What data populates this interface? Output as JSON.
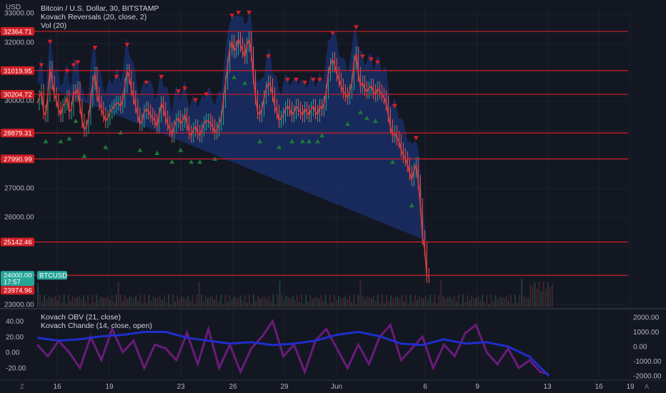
{
  "header": {
    "currency": "USD",
    "legend_lines": [
      "Bitcoin / U.S. Dollar, 30, BITSTAMP",
      "Kovach Reversals (20, close, 2)",
      "Vol (20)"
    ]
  },
  "lower_pane": {
    "legend_lines": [
      "Kovach OBV (21, close)",
      "Kovach Chande (14, close, open)"
    ]
  },
  "colors": {
    "background": "#131722",
    "grid": "#1e222d",
    "hline": "#d11f26",
    "label_red": "#d11f26",
    "label_green": "#26a69a",
    "band": "#1e3a8a",
    "up_marker": "#1b7a3a",
    "down_marker": "#d11f26",
    "obv": "#1f2ecc",
    "chande": "#6a1b7a"
  },
  "icons": {
    "bottom_left": "Z",
    "bottom_right": "A"
  },
  "chart_data": [
    {
      "type": "line",
      "name": "BTCUSD price",
      "y_axis_ticks": [
        "33000.00",
        "32000.00",
        "30000.00",
        "27000.00",
        "26000.00",
        "23000.00"
      ],
      "ylim": [
        23000,
        33000
      ],
      "x_tick_labels": [
        "16",
        "19",
        "23",
        "26",
        "29",
        "Jun",
        "6",
        "9",
        "13",
        "16",
        "19"
      ],
      "horizontal_levels": [
        32364.71,
        31019.95,
        30204.72,
        28879.31,
        27990.99,
        25142.46,
        24000.0
      ],
      "price_labels": [
        {
          "text": "32364.71",
          "kind": "level"
        },
        {
          "text": "31019.95",
          "kind": "level"
        },
        {
          "text": "30204.72",
          "kind": "level"
        },
        {
          "text": "28879.31",
          "kind": "level"
        },
        {
          "text": "27990.99",
          "kind": "level"
        },
        {
          "text": "25142.46",
          "kind": "level"
        },
        {
          "text": "24000.00",
          "kind": "current"
        },
        {
          "text": "17:57",
          "kind": "countdown"
        },
        {
          "text": "23974.96",
          "kind": "level"
        }
      ],
      "symbol_tag": "BTCUSD",
      "x": [
        0,
        3,
        6,
        9,
        12,
        15,
        18,
        21,
        24,
        27,
        30,
        33,
        36,
        39,
        42,
        45,
        48,
        51,
        54,
        57,
        60,
        63,
        66,
        69,
        72,
        75,
        78,
        81,
        84,
        87,
        90,
        93,
        96,
        99,
        102,
        105,
        108,
        111,
        114,
        117,
        120,
        123,
        126,
        129,
        132,
        135,
        138,
        141,
        144,
        147,
        150,
        153,
        156,
        159,
        162,
        165,
        168,
        171,
        174,
        177,
        180,
        183,
        186,
        189,
        192,
        195,
        198,
        201,
        204,
        207,
        210,
        213,
        216,
        219,
        222,
        225,
        228,
        231,
        234,
        237,
        240,
        243,
        246,
        249,
        252,
        255,
        258,
        261,
        264,
        267,
        270,
        273,
        276,
        279,
        282,
        285,
        288,
        291,
        294,
        297,
        300,
        303,
        306,
        309,
        312,
        315,
        318,
        321,
        324,
        327,
        330,
        333,
        336,
        339,
        342,
        345,
        348,
        351,
        354,
        357,
        360,
        363,
        366,
        369,
        372,
        375,
        378,
        381,
        384,
        387,
        390,
        393,
        396,
        399,
        402,
        405,
        408,
        411,
        414,
        417,
        420,
        423,
        426,
        429,
        432,
        435,
        438,
        441,
        444,
        447,
        450,
        453,
        456,
        459,
        462,
        465,
        468,
        471,
        474,
        477,
        480,
        483,
        486,
        489,
        492,
        495,
        498,
        501,
        504,
        507,
        510,
        513,
        516,
        519,
        522,
        525,
        528,
        531,
        534,
        537,
        540,
        543,
        546,
        549,
        552,
        555,
        558,
        561,
        564,
        567,
        570,
        573,
        576,
        579,
        582,
        585,
        588,
        591,
        594,
        597,
        600,
        603,
        606,
        609,
        612,
        615,
        618,
        621,
        624,
        627,
        630,
        633,
        636,
        639,
        642,
        645,
        648,
        651,
        654,
        657,
        660,
        663,
        666,
        669,
        672,
        675,
        678,
        681,
        684,
        687,
        690,
        693,
        696,
        699,
        702,
        705,
        708,
        711,
        714,
        717
      ],
      "y": [
        29900,
        30100,
        30300,
        29600,
        29500,
        30200,
        31100,
        30600,
        30200,
        30000,
        29700,
        29500,
        29800,
        29900,
        30100,
        29600,
        29700,
        30300,
        30200,
        30400,
        29800,
        29300,
        29000,
        29100,
        29400,
        30000,
        30600,
        30900,
        30200,
        29900,
        29700,
        29500,
        29300,
        29400,
        29600,
        29700,
        29800,
        29900,
        29900,
        29800,
        30000,
        30500,
        31000,
        30800,
        30400,
        30100,
        29800,
        29500,
        29200,
        29300,
        29600,
        29700,
        29600,
        29500,
        29400,
        29300,
        29100,
        29500,
        29900,
        29700,
        29400,
        29200,
        29000,
        28800,
        29100,
        29300,
        29400,
        29200,
        29300,
        29500,
        29200,
        28900,
        28800,
        29000,
        29100,
        28900,
        28800,
        29000,
        29200,
        29300,
        29300,
        29200,
        29100,
        28900,
        29000,
        29200,
        29400,
        30000,
        30600,
        31200,
        31800,
        32000,
        31700,
        31800,
        32100,
        31900,
        31700,
        31500,
        31900,
        32100,
        31600,
        30800,
        30100,
        29600,
        29500,
        29700,
        30100,
        30400,
        30600,
        30500,
        30200,
        29800,
        29600,
        29300,
        29400,
        29500,
        29700,
        29800,
        29700,
        29500,
        29600,
        29800,
        29700,
        29600,
        29500,
        29700,
        29600,
        29500,
        29700,
        29800,
        29600,
        29500,
        29800,
        29700,
        29900,
        30300,
        30900,
        31200,
        31400,
        31200,
        30900,
        30700,
        30500,
        30300,
        30200,
        30100,
        30300,
        30600,
        31300,
        31600,
        30900,
        30500,
        30600,
        30400,
        30300,
        30400,
        30500,
        30300,
        30200,
        30400,
        30300,
        30200,
        30100,
        29900,
        29500,
        29100,
        28800,
        28900,
        28700,
        28600,
        28300,
        28100,
        28000,
        27800,
        27500,
        27300,
        27600,
        27800,
        27200,
        26400,
        25300,
        24900,
        24000,
        23975
      ]
    },
    {
      "type": "line",
      "name": "Kovach OBV",
      "y_axis_ticks": [
        "2000.00",
        "1000.00",
        "0.00",
        "-1000.00",
        "-2000.00"
      ],
      "ylim": [
        -2000,
        2000
      ],
      "x": [
        0,
        30,
        60,
        90,
        120,
        150,
        180,
        210,
        240,
        270,
        300,
        330,
        360,
        390,
        420,
        450,
        480,
        510,
        540,
        570,
        600,
        630,
        660,
        690,
        717
      ],
      "y": [
        600,
        400,
        500,
        700,
        800,
        1000,
        1000,
        600,
        400,
        200,
        300,
        100,
        200,
        400,
        800,
        1000,
        700,
        200,
        100,
        500,
        200,
        300,
        0,
        -700,
        -2000
      ]
    },
    {
      "type": "line",
      "name": "Kovach Chande",
      "y_axis_ticks": [
        "40.00",
        "20.00",
        "0.00",
        "-20.00"
      ],
      "ylim": [
        -30,
        45
      ],
      "x": [
        0,
        15,
        30,
        45,
        60,
        75,
        90,
        105,
        120,
        135,
        150,
        165,
        180,
        195,
        210,
        225,
        240,
        255,
        270,
        285,
        300,
        315,
        330,
        345,
        360,
        375,
        390,
        405,
        420,
        435,
        450,
        465,
        480,
        495,
        510,
        525,
        540,
        555,
        570,
        585,
        600,
        615,
        630,
        645,
        660,
        675,
        690,
        705,
        717
      ],
      "y": [
        10,
        -5,
        15,
        0,
        -20,
        20,
        -10,
        30,
        0,
        15,
        -20,
        10,
        5,
        -10,
        25,
        -15,
        30,
        -20,
        10,
        -25,
        5,
        20,
        40,
        -5,
        10,
        -25,
        15,
        30,
        5,
        -20,
        10,
        -15,
        20,
        35,
        -10,
        5,
        20,
        -20,
        10,
        -5,
        25,
        35,
        0,
        -15,
        5,
        -20,
        -10,
        -25,
        -28
      ]
    }
  ]
}
